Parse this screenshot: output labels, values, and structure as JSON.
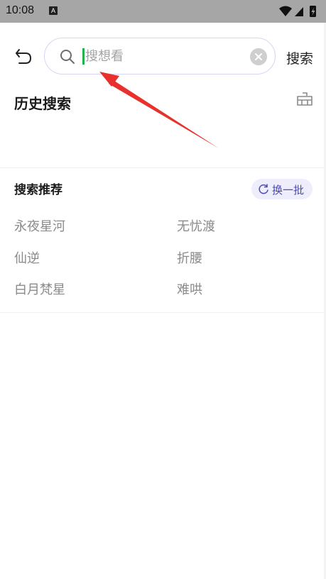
{
  "status_bar": {
    "time": "10:08",
    "notification_badge": "A",
    "icons": [
      "wifi-icon",
      "signal-icon",
      "battery-icon"
    ]
  },
  "header": {
    "back_icon": "back-icon",
    "search": {
      "placeholder": "搜想看",
      "value": "",
      "icon": "search-icon",
      "clear_icon": "clear-icon"
    },
    "search_button_label": "搜索"
  },
  "history": {
    "title": "历史搜索",
    "clear_icon": "trash-icon",
    "items": []
  },
  "recommend": {
    "title": "搜索推荐",
    "refresh_label": "换一批",
    "refresh_icon": "refresh-icon",
    "items": [
      "永夜星河",
      "无忧渡",
      "仙逆",
      "折腰",
      "白月梵星",
      "难哄"
    ]
  },
  "colors": {
    "accent": "#4b4ab5",
    "accent_bg": "#eeedfc",
    "cursor": "#22b14c",
    "annotation_arrow": "#e8302c",
    "statusbar": "#a6a6a6"
  }
}
